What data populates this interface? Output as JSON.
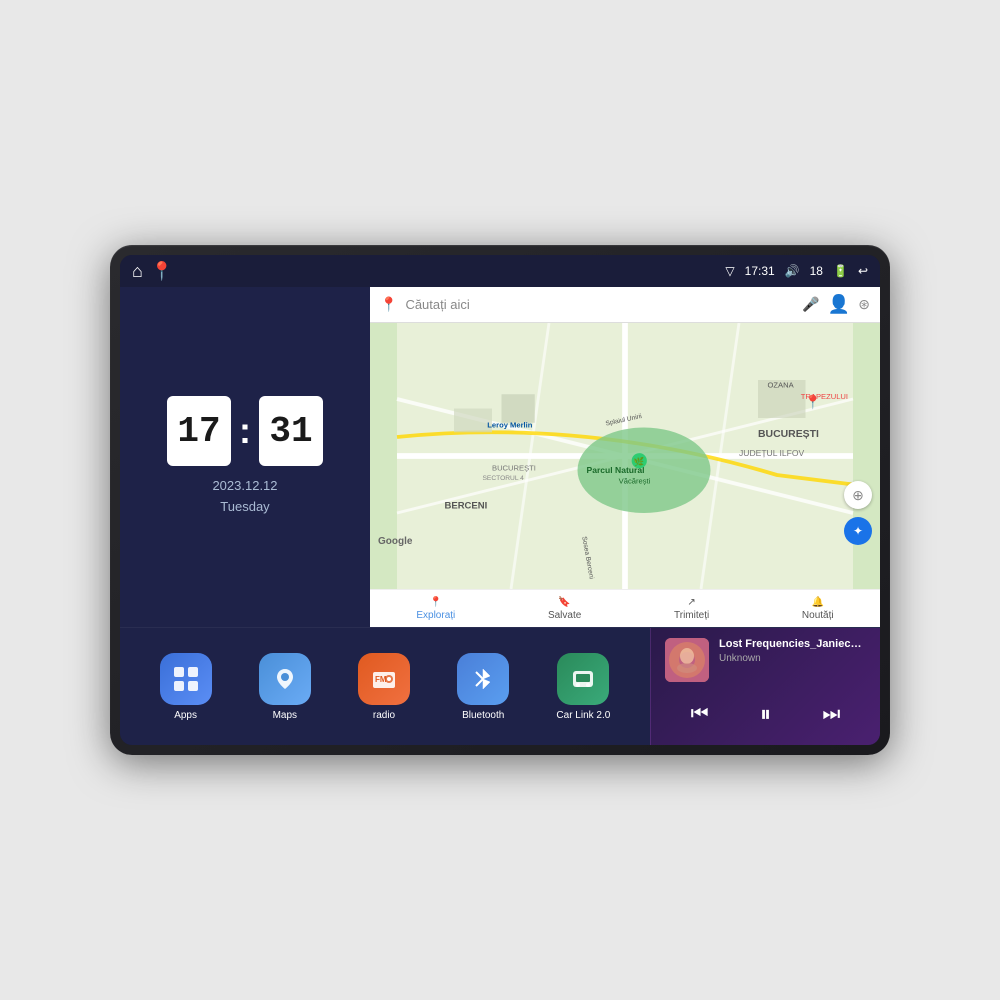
{
  "device": {
    "screen": {
      "status_bar": {
        "time": "17:31",
        "signal_strength": "18",
        "left_icons": [
          "home",
          "maps"
        ],
        "right_icons": [
          "signal",
          "time",
          "volume",
          "battery",
          "back"
        ]
      },
      "clock": {
        "hours": "17",
        "minutes": "31",
        "date": "2023.12.12",
        "day": "Tuesday"
      },
      "map": {
        "search_placeholder": "Căutați aici",
        "location_label": "Parcul Natural Văcărești",
        "area_label": "BUCUREȘTI",
        "district_label": "JUDEȚUL ILFOV",
        "nav_items": [
          {
            "label": "Explorați",
            "active": true
          },
          {
            "label": "Salvate",
            "active": false
          },
          {
            "label": "Trimiteți",
            "active": false
          },
          {
            "label": "Noutăți",
            "active": false
          }
        ]
      },
      "apps": [
        {
          "id": "apps",
          "label": "Apps",
          "icon": "⊞"
        },
        {
          "id": "maps",
          "label": "Maps",
          "icon": "📍"
        },
        {
          "id": "radio",
          "label": "radio",
          "icon": "📻"
        },
        {
          "id": "bluetooth",
          "label": "Bluetooth",
          "icon": "🔷"
        },
        {
          "id": "carlink",
          "label": "Car Link 2.0",
          "icon": "📱"
        }
      ],
      "music": {
        "title": "Lost Frequencies_Janieck Devy-...",
        "artist": "Unknown",
        "controls": {
          "prev": "⏮",
          "play": "⏸",
          "next": "⏭"
        }
      }
    }
  }
}
